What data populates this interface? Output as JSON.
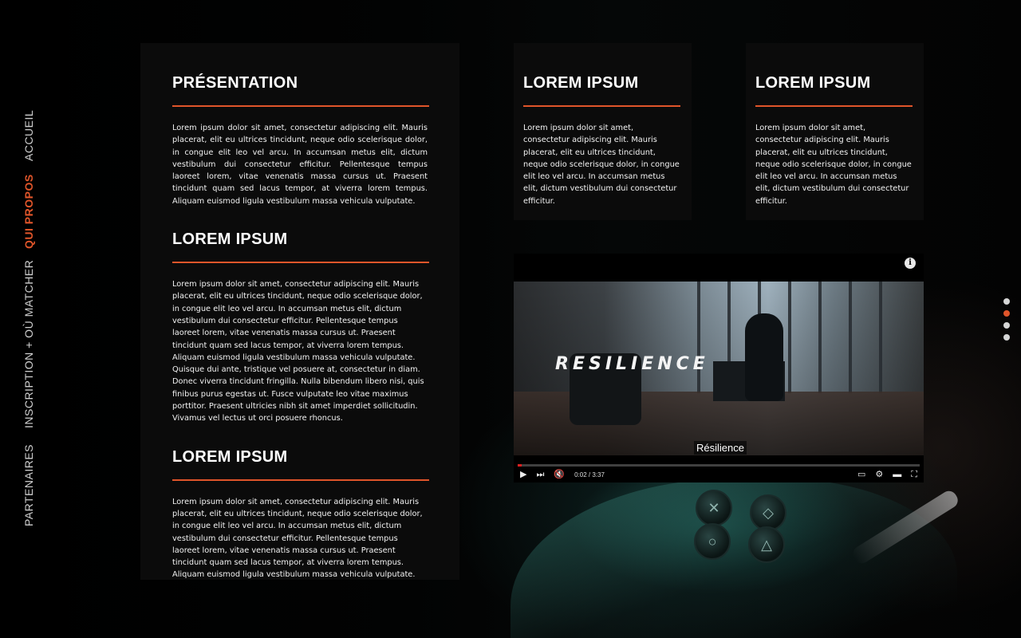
{
  "nav": {
    "items": [
      {
        "label": "ACCUEIL",
        "active": false
      },
      {
        "label": "QUI PROPOS",
        "active": true
      },
      {
        "label": "INSCRIPTION + OÙ MATCHER",
        "active": false
      },
      {
        "label": "PARTENAIRES",
        "active": false
      }
    ]
  },
  "main_panel": {
    "sections": [
      {
        "title": "PRÉSENTATION",
        "text": "Lorem ipsum dolor sit amet, consectetur adipiscing elit. Mauris placerat, elit eu ultrices tincidunt, neque odio scelerisque dolor, in congue elit leo vel arcu. In accumsan metus elit, dictum vestibulum dui consectetur efficitur. Pellentesque tempus laoreet lorem, vitae venenatis massa cursus ut. Praesent tincidunt quam sed lacus tempor, at viverra lorem tempus. Aliquam euismod ligula vestibulum massa vehicula vulputate."
      },
      {
        "title": "LOREM IPSUM",
        "text": "Lorem ipsum dolor sit amet, consectetur adipiscing elit. Mauris placerat, elit eu ultrices tincidunt, neque odio scelerisque dolor, in congue elit leo vel arcu. In accumsan metus elit, dictum vestibulum dui consectetur efficitur. Pellentesque tempus laoreet lorem, vitae venenatis massa cursus ut. Praesent tincidunt quam sed lacus tempor, at viverra lorem tempus. Aliquam euismod ligula vestibulum massa vehicula vulputate. Quisque dui ante, tristique vel posuere at, consectetur in diam. Donec viverra tincidunt fringilla. Nulla bibendum libero nisi, quis finibus purus egestas ut. Fusce vulputate leo vitae maximus porttitor. Praesent ultricies nibh sit amet imperdiet sollicitudin. Vivamus vel lectus ut orci posuere rhoncus."
      },
      {
        "title": "LOREM IPSUM",
        "text": "Lorem ipsum dolor sit amet, consectetur adipiscing elit. Mauris placerat, elit eu ultrices tincidunt, neque odio scelerisque dolor, in congue elit leo vel arcu. In accumsan metus elit, dictum vestibulum dui consectetur efficitur. Pellentesque tempus laoreet lorem, vitae venenatis massa cursus ut. Praesent tincidunt quam sed lacus tempor, at viverra lorem tempus. Aliquam euismod ligula vestibulum massa vehicula vulputate."
      }
    ]
  },
  "card_a": {
    "title": "LOREM IPSUM",
    "text": "Lorem ipsum dolor sit amet, consectetur adipiscing elit. Mauris placerat, elit eu ultrices tincidunt, neque odio scelerisque dolor, in congue elit leo vel arcu. In accumsan metus elit, dictum vestibulum dui consectetur efficitur."
  },
  "card_b": {
    "title": "LOREM IPSUM",
    "text": "Lorem ipsum dolor sit amet, consectetur adipiscing elit. Mauris placerat, elit eu ultrices tincidunt, neque odio scelerisque dolor, in congue elit leo vel arcu. In accumsan metus elit, dictum vestibulum dui consectetur efficitur."
  },
  "video": {
    "title_overlay": "RESILIENCE",
    "caption": "Résilience",
    "time": "0:02 / 3:37",
    "progress": 0.01,
    "icons": {
      "info": "info-icon",
      "play": "play-icon",
      "next": "next-icon",
      "mute": "mute-icon",
      "subtitles": "subtitles-icon",
      "settings": "settings-icon",
      "theater": "theater-icon",
      "fullscreen": "fullscreen-icon"
    }
  },
  "dots": {
    "count": 4,
    "active_index": 1
  },
  "colors": {
    "accent": "#e0552a",
    "panel": "#0c0c0c",
    "background": "#000000"
  }
}
